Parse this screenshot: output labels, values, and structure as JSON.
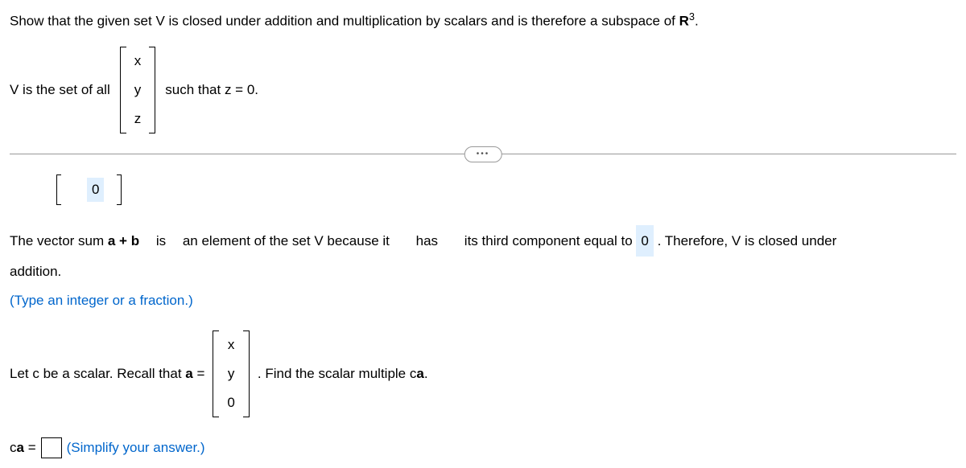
{
  "problem": {
    "statement_pre": "Show that the given set V is closed under addition and multiplication by scalars and is therefore a subspace of ",
    "space": "R",
    "exponent": "3",
    "statement_post": "."
  },
  "set_def": {
    "prefix": "V is the set of all",
    "vec": {
      "r1": "x",
      "r2": "y",
      "r3": "z"
    },
    "suffix": "such that z = 0."
  },
  "prev_answer": "0",
  "closure": {
    "p1": "The vector sum ",
    "abold": "a + b",
    "is": "is",
    "p2": "an element of the set V because it",
    "has": "has",
    "p3": "its third component equal to",
    "zero": "0",
    "p4": ". Therefore, V is closed under",
    "p5": "addition."
  },
  "hint1": "(Type an integer or a fraction.)",
  "scalar": {
    "p1": "Let c be a scalar. Recall that ",
    "abold": "a",
    "eq": " =",
    "vec": {
      "r1": "x",
      "r2": "y",
      "r3": "0"
    },
    "p2": ". Find the scalar multiple c",
    "abold2": "a",
    "p3": "."
  },
  "answer": {
    "lhs_c": "c",
    "lhs_a": "a",
    "eq": " =",
    "hint": "(Simplify your answer.)"
  }
}
